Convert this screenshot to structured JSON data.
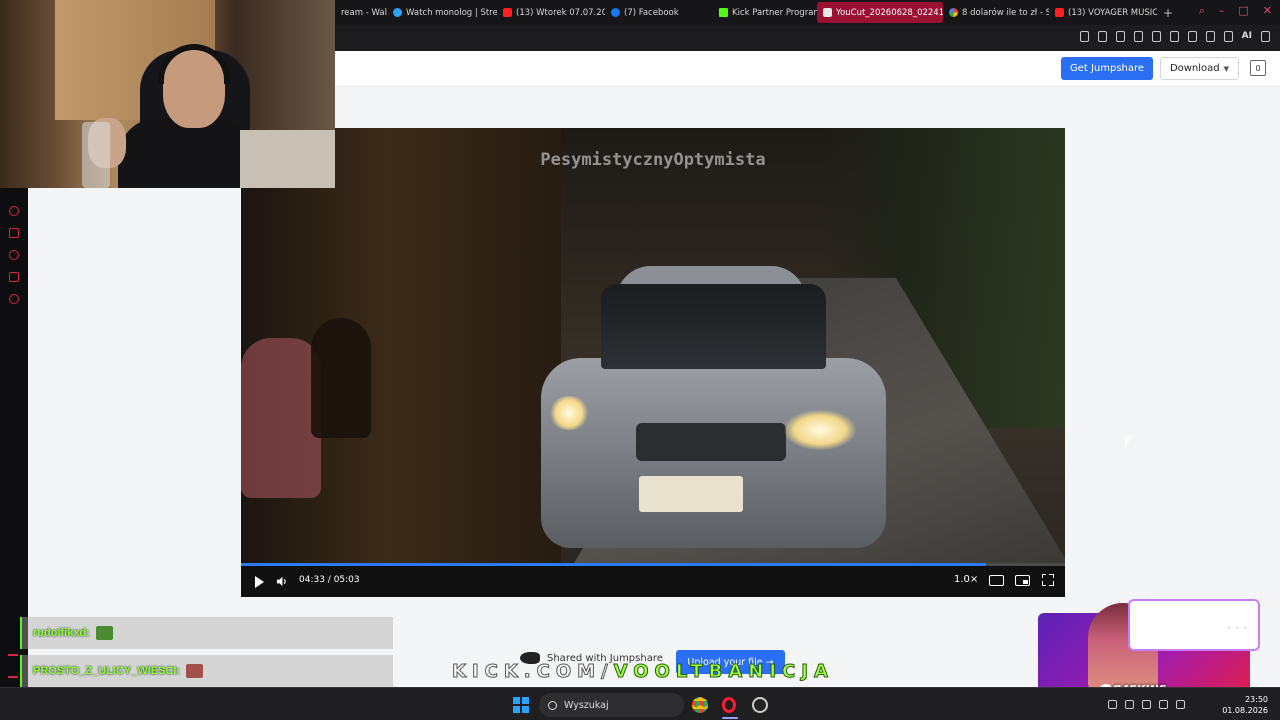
{
  "browser": {
    "tabs": [
      {
        "label": "ream - Wal",
        "favicon": "page-icon"
      },
      {
        "label": "Watch monolog | Strea",
        "favicon": "monolog-icon"
      },
      {
        "label": "(13) Wtorek 07.07.202",
        "favicon": "youtube-icon"
      },
      {
        "label": "(7) Facebook",
        "favicon": "facebook-icon"
      },
      {
        "label": "Kick Partner Program",
        "favicon": "kick-icon"
      },
      {
        "label": "YouCut_20260628_02241",
        "favicon": "youcut-icon",
        "active": true
      },
      {
        "label": "8 dolarów ile to zł - S",
        "favicon": "google-icon"
      },
      {
        "label": "(13) VOYAGER MUSIC",
        "favicon": "youtube-icon"
      }
    ],
    "new_tab": "+",
    "accent_color": "#9b1133"
  },
  "jumpshare": {
    "get_button": "Get Jumpshare",
    "download_button": "Download",
    "count_badge": "0",
    "shared_text": "Shared with Jumpshare",
    "upload_button": "Upload your file →",
    "brand_color": "#2a6ef3"
  },
  "video": {
    "watermark": "PesymistycznyOptymista",
    "time": "04:33 / 05:03",
    "speed": "1.0×",
    "progress_percent": 90.4
  },
  "chat": [
    {
      "user": "rudolfikxd:",
      "emote": "pepe-emote"
    },
    {
      "user": "PROSTO_Z_ULICY_WIESCI:",
      "emote": "face-emote"
    }
  ],
  "overlay": {
    "kick_white": "KICK.COM/",
    "kick_green": "VOOLTBANICJA"
  },
  "promo": {
    "brand": "G4SKINS",
    "dots": "- - -"
  },
  "taskbar": {
    "search_placeholder": "Wyszukaj",
    "time": "23:50",
    "date": "01.08.2026"
  }
}
